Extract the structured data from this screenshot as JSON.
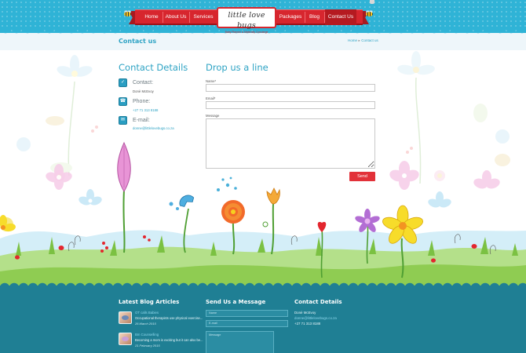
{
  "nav": {
    "items": [
      {
        "label": "Home"
      },
      {
        "label": "About Us"
      },
      {
        "label": "Services"
      },
      {
        "label": "Packages"
      },
      {
        "label": "Blog"
      },
      {
        "label": "Contact Us"
      }
    ],
    "active": "Contact Us"
  },
  "logo": {
    "text": "little love bugs",
    "tagline": "Baby Planner & Maternity Concierge"
  },
  "titlebar": {
    "title": "Contact us",
    "breadcrumb": [
      "Home",
      "Contact us"
    ]
  },
  "contact_details": {
    "heading": "Contact Details",
    "contact_label": "Contact:",
    "contact_value": "Donè McEvoy",
    "phone_label": "Phone:",
    "phone_value": "+27 71 313 8188",
    "email_label": "E-mail:",
    "email_value": "donne@littlelovebugs.co.za"
  },
  "form": {
    "heading": "Drop us a line",
    "name_label": "Name*",
    "email_label": "Email*",
    "message_label": "Message",
    "send_label": "Send"
  },
  "footer": {
    "blog": {
      "heading": "Latest Blog Articles",
      "articles": [
        {
          "title": "OT calls Babies",
          "excerpt": "Occupational therapists use physical exercise...",
          "date": "26 March 2015"
        },
        {
          "title": "Bm Counselling",
          "excerpt": "Becoming a mom is exciting but it can also be...",
          "date": "21 February 2015"
        }
      ]
    },
    "message": {
      "heading": "Send Us a Message",
      "name_placeholder": "Name",
      "email_placeholder": "E-mail",
      "message_placeholder": "Message"
    },
    "contact": {
      "heading": "Contact Details",
      "name": "Donè McEvoy",
      "email": "donne@littlelovebugs.co.za",
      "phone": "+27 71 313 8188"
    }
  },
  "colors": {
    "header_blue": "#2fb3d6",
    "ribbon_red": "#d7262e",
    "title_blue": "#2ea3c4",
    "footer_teal": "#1f7f94",
    "send_red": "#e23139"
  },
  "icons": {
    "contact": "check-icon",
    "phone": "phone-icon",
    "email": "mail-icon"
  }
}
